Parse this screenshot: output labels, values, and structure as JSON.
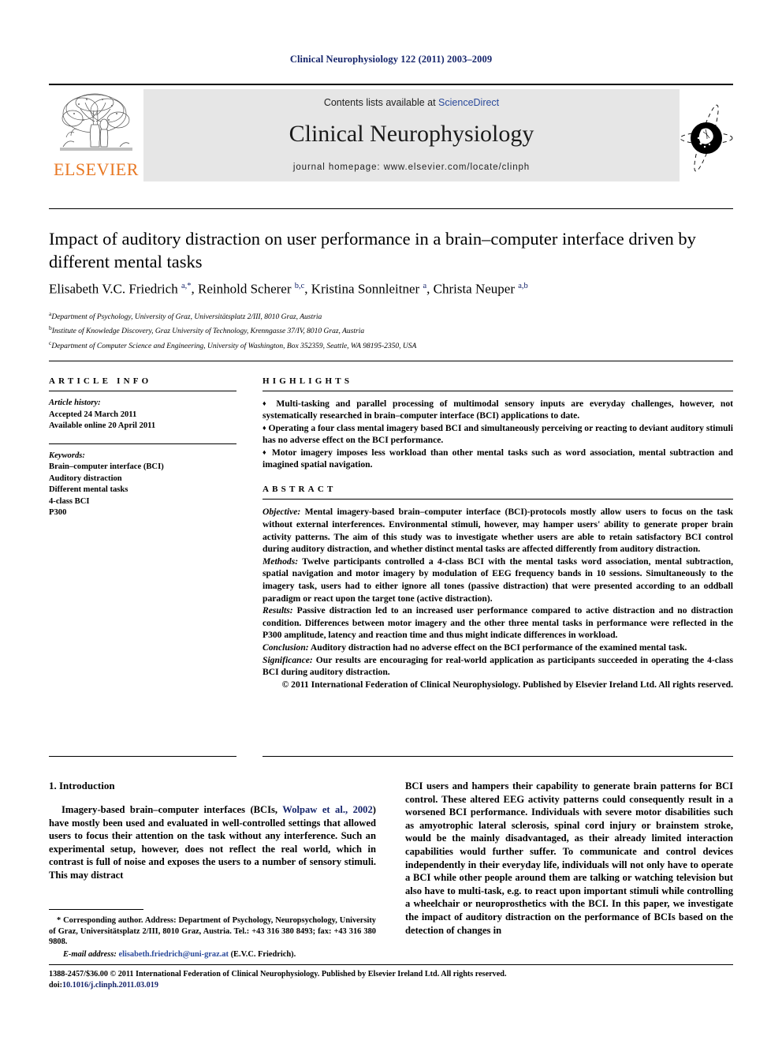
{
  "running_head": "Clinical Neurophysiology 122 (2011) 2003–2009",
  "masthead": {
    "publisher_name": "ELSEVIER",
    "contents_prefix": "Contents lists available at ",
    "sciencedirect": "ScienceDirect",
    "journal_title": "Clinical Neurophysiology",
    "homepage": "journal homepage: www.elsevier.com/locate/clinph",
    "banner_bg": "#e6e6e6",
    "elsevier_orange": "#e87722",
    "link_blue": "#2b4a9b"
  },
  "article": {
    "title": "Impact of auditory distraction on user performance in a brain–computer interface driven by different mental tasks",
    "authors_html": "Elisabeth V.C. Friedrich <sup>a,*</sup>, Reinhold Scherer <sup>b,c</sup>, Kristina Sonnleitner <sup>a</sup>, Christa Neuper <sup>a,b</sup>",
    "affiliations": [
      {
        "marker": "a",
        "text": "Department of Psychology, University of Graz, Universitätsplatz 2/III, 8010 Graz, Austria"
      },
      {
        "marker": "b",
        "text": "Institute of Knowledge Discovery, Graz University of Technology, Krenngasse 37/IV, 8010 Graz, Austria"
      },
      {
        "marker": "c",
        "text": "Department of Computer Science and Engineering, University of Washington, Box 352359, Seattle, WA 98195-2350, USA"
      }
    ]
  },
  "article_info": {
    "heading": "ARTICLE INFO",
    "history_label": "Article history:",
    "history": [
      "Accepted 24 March 2011",
      "Available online 20 April 2011"
    ],
    "keywords_label": "Keywords:",
    "keywords": [
      "Brain–computer interface (BCI)",
      "Auditory distraction",
      "Different mental tasks",
      "4-class BCI",
      "P300"
    ]
  },
  "highlights": {
    "heading": "HIGHLIGHTS",
    "bullet_glyph": "♦",
    "items": [
      "Multi-tasking and parallel processing of multimodal sensory inputs are everyday challenges, however, not systematically researched in brain–computer interface (BCI) applications to date.",
      "Operating a four class mental imagery based BCI and simultaneously perceiving or reacting to deviant auditory stimuli has no adverse effect on the BCI performance.",
      "Motor imagery imposes less workload than other mental tasks such as word association, mental subtraction and imagined spatial navigation."
    ]
  },
  "abstract": {
    "heading": "ABSTRACT",
    "sections": [
      {
        "label": "Objective:",
        "text": " Mental imagery-based brain–computer interface (BCI)-protocols mostly allow users to focus on the task without external interferences. Environmental stimuli, however, may hamper users' ability to generate proper brain activity patterns. The aim of this study was to investigate whether users are able to retain satisfactory BCI control during auditory distraction, and whether distinct mental tasks are affected differently from auditory distraction."
      },
      {
        "label": "Methods:",
        "text": " Twelve participants controlled a 4-class BCI with the mental tasks word association, mental subtraction, spatial navigation and motor imagery by modulation of EEG frequency bands in 10 sessions. Simultaneously to the imagery task, users had to either ignore all tones (passive distraction) that were presented according to an oddball paradigm or react upon the target tone (active distraction)."
      },
      {
        "label": "Results:",
        "text": " Passive distraction led to an increased user performance compared to active distraction and no distraction condition. Differences between motor imagery and the other three mental tasks in performance were reflected in the P300 amplitude, latency and reaction time and thus might indicate differences in workload."
      },
      {
        "label": "Conclusion:",
        "text": " Auditory distraction had no adverse effect on the BCI performance of the examined mental task."
      },
      {
        "label": "Significance:",
        "text": " Our results are encouraging for real-world application as participants succeeded in operating the 4-class BCI during auditory distraction."
      }
    ],
    "copyright": "© 2011 International Federation of Clinical Neurophysiology. Published by Elsevier Ireland Ltd. All rights reserved."
  },
  "body": {
    "section_heading": "1. Introduction",
    "left_paragraph_pre": "Imagery-based brain–computer interfaces (BCIs, ",
    "left_citation": "Wolpaw et al., 2002",
    "left_paragraph_post": ") have mostly been used and evaluated in well-controlled settings that allowed users to focus their attention on the task without any interference. Such an experimental setup, however, does not reflect the real world, which in contrast is full of noise and exposes the users to a number of sensory stimuli. This may distract",
    "right_paragraph": "BCI users and hampers their capability to generate brain patterns for BCI control. These altered EEG activity patterns could consequently result in a worsened BCI performance. Individuals with severe motor disabilities such as amyotrophic lateral sclerosis, spinal cord injury or brainstem stroke, would be the mainly disadvantaged, as their already limited interaction capabilities would further suffer. To communicate and control devices independently in their everyday life, individuals will not only have to operate a BCI while other people around them are talking or watching television but also have to multi-task, e.g. to react upon important stimuli while controlling a wheelchair or neuroprosthetics with the BCI. In this paper, we investigate the impact of auditory distraction on the performance of BCIs based on the detection of changes in"
  },
  "footnote": {
    "star": "*",
    "corresponding_text": " Corresponding author. Address: Department of Psychology, Neuropsychology, University of Graz, Universitätsplatz 2/III, 8010 Graz, Austria. Tel.: +43 316 380 8493; fax: +43 316 380 9808.",
    "email_label": "E-mail address:",
    "email": "elisabeth.friedrich@uni-graz.at",
    "email_owner": " (E.V.C. Friedrich)."
  },
  "footer": {
    "issn_line": "1388-2457/$36.00 © 2011 International Federation of Clinical Neurophysiology. Published by Elsevier Ireland Ltd. All rights reserved.",
    "doi_label": "doi:",
    "doi": "10.1016/j.clinph.2011.03.019"
  }
}
